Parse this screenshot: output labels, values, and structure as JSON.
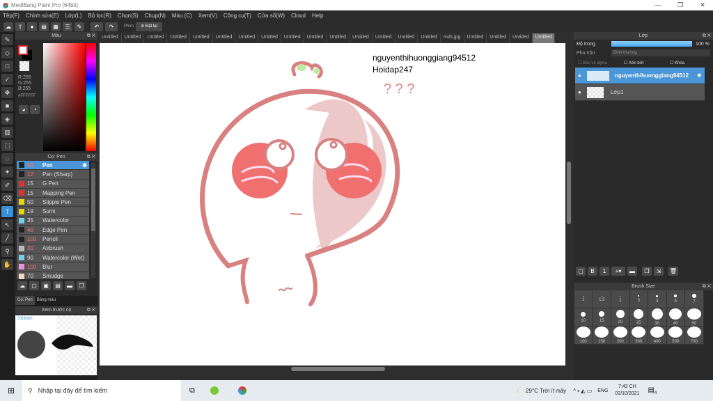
{
  "window": {
    "title": "MediBang Paint Pro (64bit)"
  },
  "menu": [
    "Tệp(F)",
    "Chỉnh sửa(E)",
    "Lớp(L)",
    "Bộ lọc(R)",
    "Chọn(S)",
    "Chụp(N)",
    "Màu (C)",
    "Xem(V)",
    "Công cụ(T)",
    "Cửa sổ(W)",
    "Cloud",
    "Help"
  ],
  "toolbar": {
    "phim_label": "Phím",
    "reset_label": "Đặt lại"
  },
  "color_panel": {
    "title": "Màu",
    "r": "R:255",
    "g": "G:255",
    "b": "B:255",
    "hex": "#FFFFFF"
  },
  "brush_panel": {
    "title": "Cọ: Pen",
    "brushes": [
      {
        "size": "50",
        "name": "Pen",
        "color": "#222222",
        "red": true
      },
      {
        "size": "12",
        "name": "Pen (Sharp)",
        "color": "#222222",
        "red": true
      },
      {
        "size": "15",
        "name": "G Pen",
        "color": "#e53030",
        "red": false
      },
      {
        "size": "15",
        "name": "Mapping Pen",
        "color": "#e53030",
        "red": false
      },
      {
        "size": "50",
        "name": "Stipple Pen",
        "color": "#e8d800",
        "red": false
      },
      {
        "size": "19",
        "name": "Sumi",
        "color": "#e8d800",
        "red": false
      },
      {
        "size": "35",
        "name": "Watercolor",
        "color": "#6fd0f0",
        "red": false
      },
      {
        "size": "40",
        "name": "Edge Pen",
        "color": "#222222",
        "red": true
      },
      {
        "size": "100",
        "name": "Pencil",
        "color": "#222222",
        "red": true
      },
      {
        "size": "30",
        "name": "Airbrush",
        "color": "#bbbbbb",
        "red": true
      },
      {
        "size": "90",
        "name": "Watercolor (Wet)",
        "color": "#6fd0f0",
        "red": false
      },
      {
        "size": "100",
        "name": "Blur",
        "color": "#f08ee0",
        "red": true
      },
      {
        "size": "70",
        "name": "Smudge",
        "color": "#f5d8c0",
        "red": false
      }
    ],
    "tabs": [
      "Cọ: Pen",
      "Bảng màu"
    ]
  },
  "preview_panel": {
    "title": "Xem trước cọ",
    "size": "3.63mm"
  },
  "doc_tabs": [
    "Untitled",
    "Untitled",
    "Untitled",
    "Untitled",
    "Untitled",
    "Untitled",
    "Untitled",
    "Untitled",
    "Untitled",
    "Untitled",
    "Untitled",
    "Untitled",
    "Untitled",
    "Untitled",
    "Untitled",
    "mds.jpg",
    "Untitled",
    "Untitled",
    "Untitled",
    "Untitled"
  ],
  "canvas_text": {
    "line1": "nguyenthihuonggiang94512",
    "line2": "Hoidap247",
    "marks": "? ? ?"
  },
  "layer_panel": {
    "title": "Lớp",
    "opacity_label": "Độ trong",
    "opacity_value": "100 %",
    "opacity": 100,
    "blend_label": "Pha trộn",
    "blend_value": "Bình thường",
    "alpha_label": "Bảo vệ alpha",
    "clip_label": "Xén bớt",
    "lock_label": "Khóa",
    "layers": [
      {
        "name": "nguyenthihuonggiang94512",
        "selected": true
      },
      {
        "name": "Lớp1",
        "selected": false
      }
    ]
  },
  "brush_size_panel": {
    "title": "Brush Size",
    "sizes": [
      "1",
      "1.5",
      "2",
      "3",
      "4",
      "5",
      "7",
      "10",
      "15",
      "20",
      "25",
      "30",
      "40",
      "50",
      "100",
      "150",
      "200",
      "300",
      "400",
      "500",
      "700"
    ]
  },
  "taskbar": {
    "search_placeholder": "Nhập tại đây để tìm kiếm",
    "weather": "29°C  Trời ít mây",
    "lang": "ENG",
    "time": "7:42 CH",
    "date": "02/10/2021",
    "notif": "4"
  }
}
